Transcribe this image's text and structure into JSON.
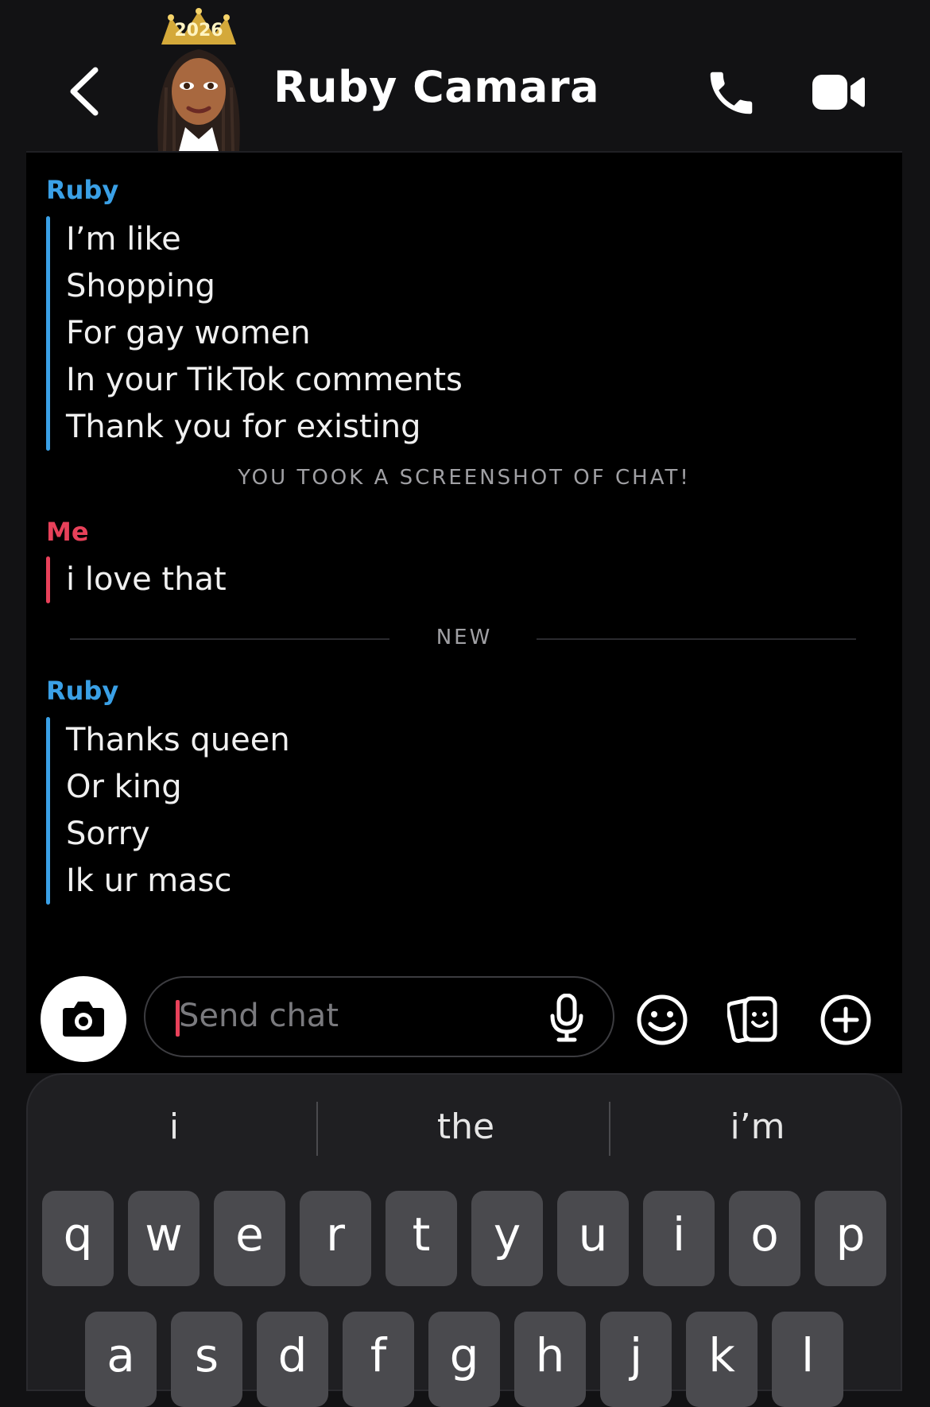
{
  "header": {
    "title": "Ruby Camara",
    "avatar_badge": "2026",
    "back_icon": "chevron-left-icon",
    "call_icon": "phone-icon",
    "video_icon": "video-camera-icon"
  },
  "conversation": {
    "blocks": [
      {
        "sender": "Ruby",
        "lines": [
          "I’m like",
          "Shopping",
          "For gay women",
          "In your TikTok comments",
          "Thank you for existing"
        ]
      },
      {
        "system": "YOU TOOK A SCREENSHOT OF CHAT!"
      },
      {
        "sender": "Me",
        "lines": [
          "i love that"
        ]
      },
      {
        "divider": "NEW"
      },
      {
        "sender": "Ruby",
        "lines": [
          "Thanks queen",
          "Or king",
          "Sorry",
          "Ik ur masc"
        ]
      }
    ]
  },
  "input": {
    "placeholder": "Send chat",
    "camera_icon": "camera-icon",
    "mic_icon": "microphone-icon",
    "emoji_icon": "emoji-icon",
    "stickers_icon": "sticker-cards-icon",
    "plus_icon": "plus-circle-icon"
  },
  "keyboard": {
    "suggestions": [
      "i",
      "the",
      "i’m"
    ],
    "row1": [
      "q",
      "w",
      "e",
      "r",
      "t",
      "y",
      "u",
      "i",
      "o",
      "p"
    ],
    "row2": [
      "a",
      "s",
      "d",
      "f",
      "g",
      "h",
      "j",
      "k",
      "l"
    ]
  },
  "colors": {
    "ruby": "#3aa0e6",
    "me": "#e8415a",
    "background": "#000000"
  }
}
